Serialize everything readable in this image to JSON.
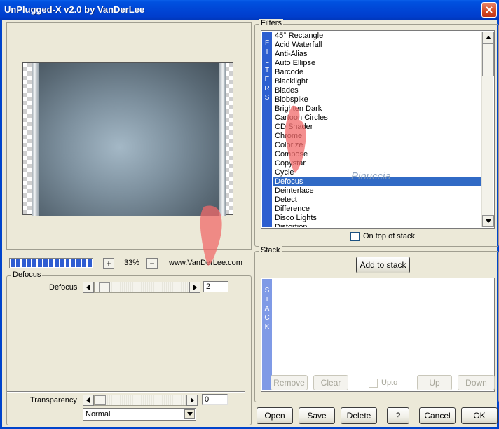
{
  "window": {
    "title": "UnPlugged-X v2.0 by VanDerLee"
  },
  "preview": {
    "zoom": "33%",
    "site": "www.VanDerLee.com",
    "progress_blocks": 15
  },
  "defocus_group": {
    "legend": "Defocus",
    "label": "Defocus",
    "value": "2"
  },
  "transparency": {
    "label": "Transparency",
    "value": "0",
    "blend_mode": "Normal"
  },
  "filters": {
    "legend": "Filters",
    "strip_text": [
      "F",
      "I",
      "L",
      "T",
      "E",
      "R",
      "S"
    ],
    "items": [
      "45° Rectangle",
      "Acid Waterfall",
      "Anti-Alias",
      "Auto Ellipse",
      "Barcode",
      "Blacklight",
      "Blades",
      "Blobspike",
      "Brighten Dark",
      "Cartoon Circles",
      "CD Shader",
      "Chrome",
      "Colorize",
      "Compose",
      "Copystar",
      "Cycle",
      "Defocus",
      "Deinterlace",
      "Detect",
      "Difference",
      "Disco Lights",
      "Distortion"
    ],
    "selected": "Defocus",
    "on_top_label": "On top of stack"
  },
  "stack": {
    "legend": "Stack",
    "add_label": "Add to stack",
    "strip_text": [
      "S",
      "T",
      "A",
      "C",
      "K"
    ],
    "remove_label": "Remove",
    "clear_label": "Clear",
    "upto_label": "Upto",
    "up_label": "Up",
    "down_label": "Down"
  },
  "buttons": {
    "open": "Open",
    "save": "Save",
    "delete": "Delete",
    "help": "?",
    "cancel": "Cancel",
    "ok": "OK"
  },
  "watermark": "Pinuccia",
  "colors": {
    "titlebar": "#0046d6",
    "selection": "#316ac5",
    "filter_strip": "#2d5fd0",
    "stack_strip": "#7f9ae6"
  }
}
